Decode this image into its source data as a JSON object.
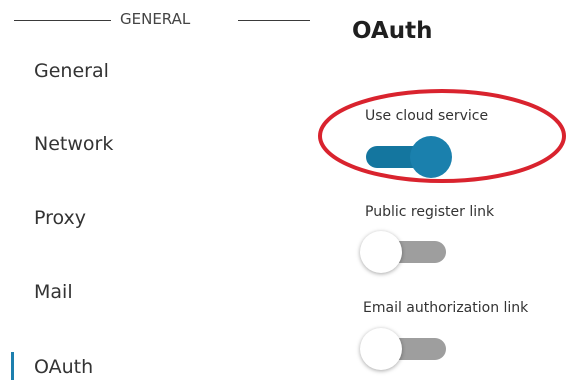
{
  "sidebar": {
    "section_title": "GENERAL",
    "items": [
      {
        "label": "General"
      },
      {
        "label": "Network"
      },
      {
        "label": "Proxy"
      },
      {
        "label": "Mail"
      },
      {
        "label": "OAuth",
        "active": true
      }
    ]
  },
  "main": {
    "title": "OAuth",
    "settings": [
      {
        "label": "Use cloud service",
        "enabled": true
      },
      {
        "label": "Public register link",
        "enabled": false
      },
      {
        "label": "Email authorization link",
        "enabled": false
      }
    ]
  },
  "colors": {
    "accent": "#1a80ad",
    "toggle_off_track": "#9e9e9e",
    "highlight": "#d9232e"
  }
}
